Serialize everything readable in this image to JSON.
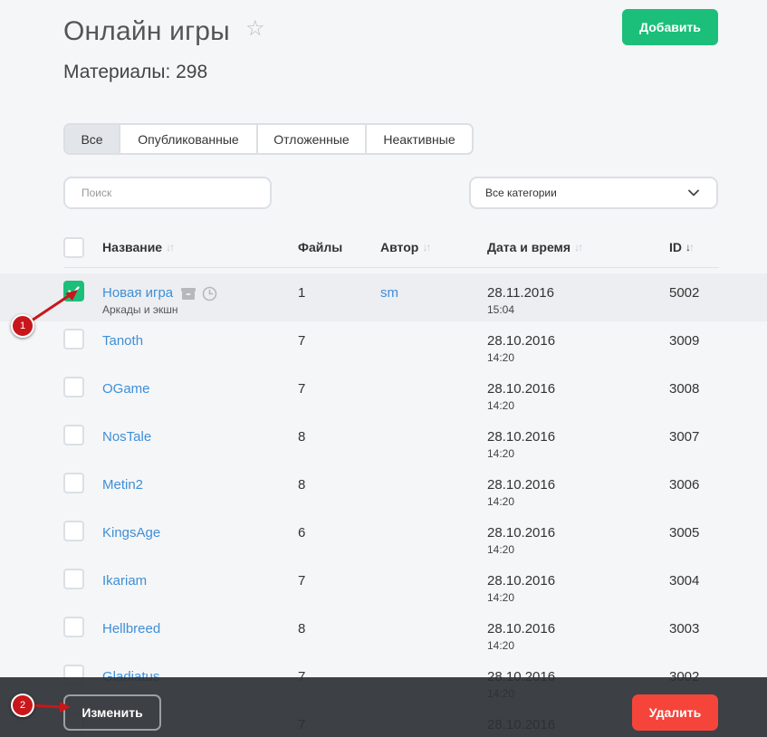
{
  "header": {
    "title": "Онлайн игры",
    "add_label": "Добавить",
    "count_label": "Материалы: 298"
  },
  "tabs": [
    "Все",
    "Опубликованные",
    "Отложенные",
    "Неактивные"
  ],
  "active_tab": "Все",
  "filters": {
    "search_placeholder": "Поиск",
    "category_value": "Все категории"
  },
  "table": {
    "columns": {
      "name": "Название",
      "files": "Файлы",
      "author": "Автор",
      "date": "Дата и время",
      "id": "ID"
    },
    "rows": [
      {
        "name": "Новая игра",
        "category": "Аркады и экшн",
        "files": "1",
        "author": "sm",
        "date": "28.11.2016",
        "time": "15:04",
        "id": "5002",
        "checked": true
      },
      {
        "name": "Tanoth",
        "files": "7",
        "author": "",
        "date": "28.10.2016",
        "time": "14:20",
        "id": "3009",
        "checked": false
      },
      {
        "name": "OGame",
        "files": "7",
        "author": "",
        "date": "28.10.2016",
        "time": "14:20",
        "id": "3008",
        "checked": false
      },
      {
        "name": "NosTale",
        "files": "8",
        "author": "",
        "date": "28.10.2016",
        "time": "14:20",
        "id": "3007",
        "checked": false
      },
      {
        "name": "Metin2",
        "files": "8",
        "author": "",
        "date": "28.10.2016",
        "time": "14:20",
        "id": "3006",
        "checked": false
      },
      {
        "name": "KingsAge",
        "files": "6",
        "author": "",
        "date": "28.10.2016",
        "time": "14:20",
        "id": "3005",
        "checked": false
      },
      {
        "name": "Ikariam",
        "files": "7",
        "author": "",
        "date": "28.10.2016",
        "time": "14:20",
        "id": "3004",
        "checked": false
      },
      {
        "name": "Hellbreed",
        "files": "8",
        "author": "",
        "date": "28.10.2016",
        "time": "14:20",
        "id": "3003",
        "checked": false
      },
      {
        "name": "Gladiatus",
        "files": "7",
        "author": "",
        "date": "28.10.2016",
        "time": "14:20",
        "id": "3002",
        "checked": false
      },
      {
        "name": "",
        "files": "7",
        "author": "",
        "date": "28.10.2016",
        "time": "",
        "id": "",
        "checked": false
      }
    ]
  },
  "bottom_bar": {
    "edit_label": "Изменить",
    "delete_label": "Удалить"
  },
  "annotations": [
    "1",
    "2"
  ],
  "colors": {
    "accent_green": "#1bbf7a",
    "link_blue": "#3f8fd6",
    "danger_red": "#f5453b",
    "badge_red": "#c8171b",
    "bar_dark": "#2d3034"
  }
}
